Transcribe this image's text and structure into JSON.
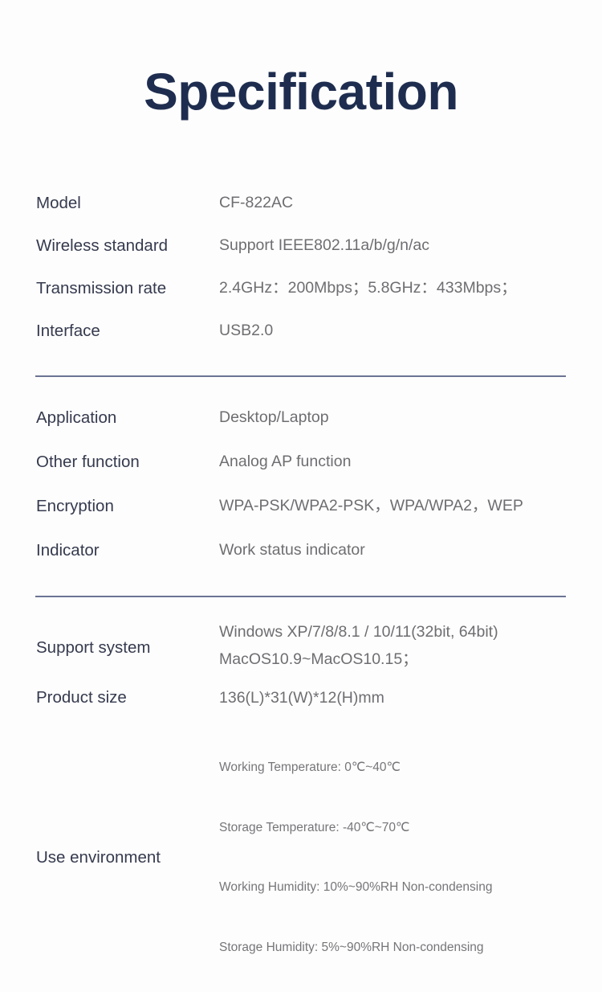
{
  "page": {
    "title": "Specification",
    "background_color": "#fdfdfd",
    "title_color": "#1e2d4f",
    "label_color": "#353a4e",
    "value_color": "#6e6e72",
    "divider_color": "#6b7494"
  },
  "sections": [
    {
      "rows": [
        {
          "label": "Model",
          "value": "CF-822AC"
        },
        {
          "label": "Wireless standard",
          "value": "Support IEEE802.11a/b/g/n/ac"
        },
        {
          "label": "Transmission rate",
          "value": "2.4GHz：200Mbps；5.8GHz：433Mbps；"
        },
        {
          "label": "Interface",
          "value": "USB2.0"
        }
      ]
    },
    {
      "rows": [
        {
          "label": "Application",
          "value": "Desktop/Laptop"
        },
        {
          "label": "Other function",
          "value": "Analog AP function"
        },
        {
          "label": "Encryption",
          "value": "WPA-PSK/WPA2-PSK，WPA/WPA2，WEP"
        },
        {
          "label": "Indicator",
          "value": "Work status indicator"
        }
      ]
    },
    {
      "rows": [
        {
          "label": "Support system",
          "value": "Windows XP/7/8/8.1 / 10/11(32bit, 64bit)\nMacOS10.9~MacOS10.15；"
        },
        {
          "label": "Product size",
          "value": "136(L)*31(W)*12(H)mm"
        }
      ]
    }
  ],
  "use_environment": {
    "label": "Use environment",
    "lines": [
      "Working Temperature: 0℃~40℃",
      "Storage Temperature: -40℃~70℃",
      "Working Humidity: 10%~90%RH Non-condensing",
      "Storage Humidity: 5%~90%RH Non-condensing"
    ]
  }
}
